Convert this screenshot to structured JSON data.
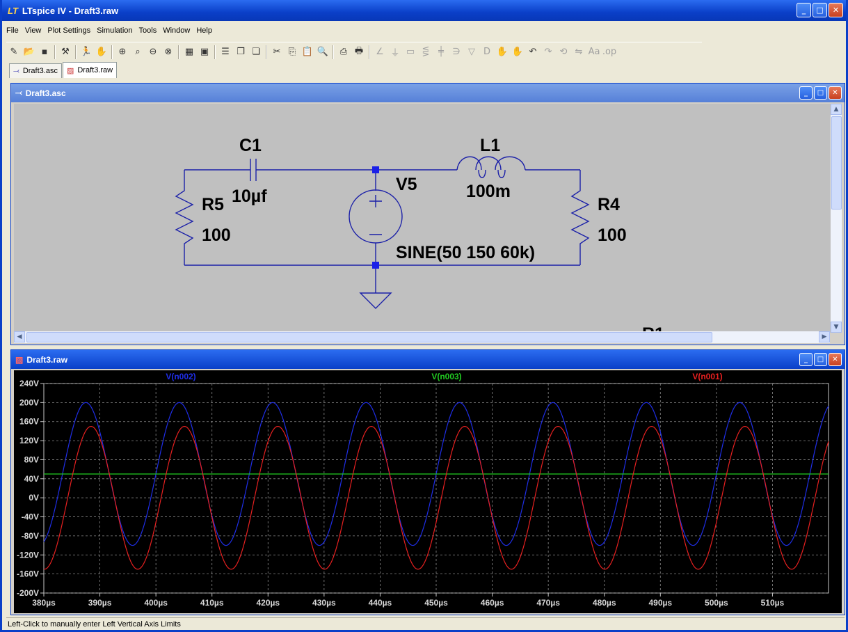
{
  "window": {
    "title": "LTspice IV - Draft3.raw"
  },
  "menu": [
    "File",
    "View",
    "Plot Settings",
    "Simulation",
    "Tools",
    "Window",
    "Help"
  ],
  "tabs": [
    {
      "label": "Draft3.asc"
    },
    {
      "label": "Draft3.raw"
    }
  ],
  "schematic": {
    "title": "Draft3.asc",
    "components": {
      "c1_name": "C1",
      "c1_value": "10µf",
      "l1_name": "L1",
      "l1_value": "100m",
      "r5_name": "R5",
      "r5_value": "100",
      "r4_name": "R4",
      "r4_value": "100",
      "v5_name": "V5",
      "v5_value": "SINE(50 150 60k)",
      "partial_label": "R1"
    }
  },
  "waveform": {
    "title": "Draft3.raw",
    "chart_data": {
      "type": "line",
      "x_unit": "µs",
      "xlim": [
        380,
        520
      ],
      "ylim": [
        -200,
        240
      ],
      "x_ticks": [
        380,
        390,
        400,
        410,
        420,
        430,
        440,
        450,
        460,
        470,
        480,
        490,
        500,
        510
      ],
      "x_tick_labels": [
        "380µs",
        "390µs",
        "400µs",
        "410µs",
        "420µs",
        "430µs",
        "440µs",
        "450µs",
        "460µs",
        "470µs",
        "480µs",
        "490µs",
        "500µs",
        "510µs"
      ],
      "y_ticks": [
        240,
        200,
        160,
        120,
        80,
        40,
        0,
        -40,
        -80,
        -120,
        -160,
        -200
      ],
      "y_tick_labels": [
        "240V",
        "200V",
        "160V",
        "120V",
        "80V",
        "40V",
        "0V",
        "-40V",
        "-80V",
        "-120V",
        "-160V",
        "-200V"
      ],
      "grid": true,
      "background": "#000000",
      "series": [
        {
          "name": "V(n002)",
          "color": "#1f2ee8",
          "offset_v": 50,
          "amplitude_v": 150,
          "frequency_khz": 60,
          "phase_deg": 0
        },
        {
          "name": "V(n003)",
          "color": "#22cc22",
          "offset_v": 50,
          "amplitude_v": 0,
          "frequency_khz": 60,
          "phase_deg": 0
        },
        {
          "name": "V(n001)",
          "color": "#e82020",
          "offset_v": 0,
          "amplitude_v": 150,
          "frequency_khz": 60,
          "phase_deg": -20
        }
      ]
    }
  },
  "status": {
    "text": "Left-Click to manually enter Left Vertical Axis Limits"
  }
}
